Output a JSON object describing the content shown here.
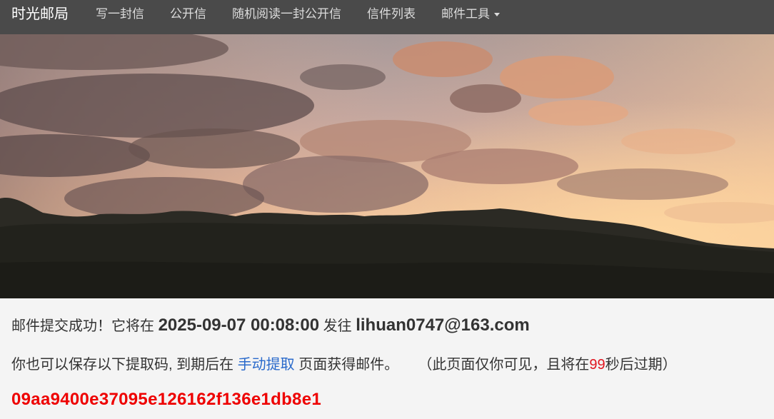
{
  "nav": {
    "brand": "时光邮局",
    "items": [
      {
        "label": "写一封信"
      },
      {
        "label": "公开信"
      },
      {
        "label": "随机阅读一封公开信"
      },
      {
        "label": "信件列表"
      },
      {
        "label": "邮件工具"
      }
    ]
  },
  "message": {
    "success_prefix": "邮件提交成功！它将在",
    "datetime": "2025-09-07 00:08:00",
    "send_to": "发往",
    "email": "lihuan0747@163.com",
    "save_text": "你也可以保存以下提取码, 到期后在",
    "link_text": "手动提取",
    "after_link": "页面获得邮件。",
    "note_prefix": "（此页面仅你可见，且将在",
    "countdown": "99",
    "note_suffix": "秒后过期）",
    "code": "09aa9400e37095e126162f136e1db8e1"
  },
  "colors": {
    "navbar": "#4a4a4a",
    "link": "#2a6acb",
    "code": "#ee0000",
    "countdown": "#e0141e"
  }
}
